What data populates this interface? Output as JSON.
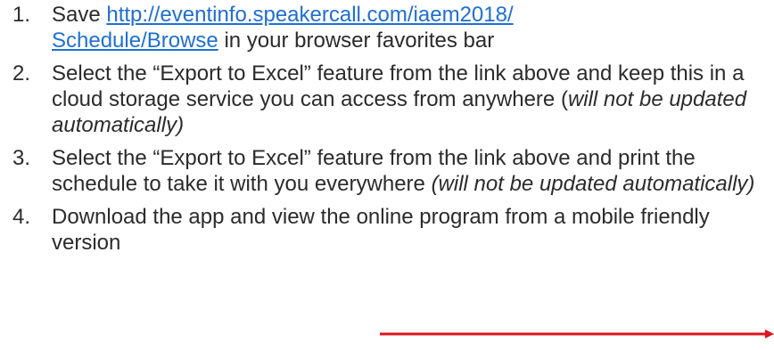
{
  "steps": [
    {
      "number": "1.",
      "pre": "Save ",
      "link_line1": "http://eventinfo.speakercall.com/iaem2018/",
      "link_line2": "Schedule/Browse",
      "post": " in your browser favorites bar"
    },
    {
      "number": "2.",
      "text": "Select the “Export to Excel” feature from the link above and keep this in a cloud storage service you can access from anywhere (",
      "italic": "will not be updated automatically)"
    },
    {
      "number": "3.",
      "text": "Select the “Export to Excel” feature from the link above and print the schedule to take it with you everywhere ",
      "italic": "(will not be updated automatically)"
    },
    {
      "number": "4.",
      "text": "Download the app and view the online program from a mobile friendly version"
    }
  ],
  "colors": {
    "text": "#2b2b2b",
    "link": "#1f6fd1",
    "arrow": "#e0141e"
  }
}
